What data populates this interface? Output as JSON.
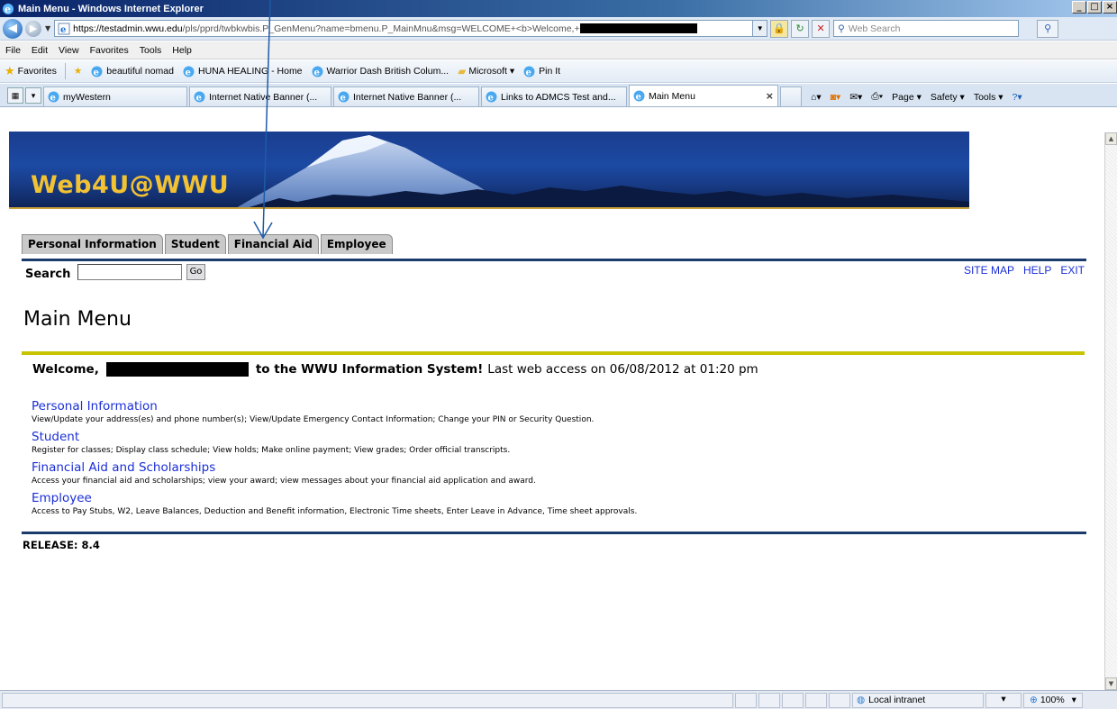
{
  "window": {
    "title": "Main Menu - Windows Internet Explorer",
    "min": "_",
    "max": "□",
    "close": "×"
  },
  "address": {
    "host": "https://testadmin.wwu.edu",
    "rest": "/pls/pprd/twbkwbis.P_GenMenu?name=bmenu.P_MainMnu&msg=WELCOME+<b>Welcome,+",
    "search_placeholder": "Web Search"
  },
  "menu": [
    "File",
    "Edit",
    "View",
    "Favorites",
    "Tools",
    "Help"
  ],
  "favorites": {
    "label": "Favorites",
    "items": [
      "beautiful nomad",
      "HUNA HEALING - Home",
      "Warrior Dash  British Colum...",
      "Microsoft ▾",
      "Pin It"
    ]
  },
  "tabs": [
    {
      "label": "myWestern"
    },
    {
      "label": "Internet Native Banner (..."
    },
    {
      "label": "Internet Native Banner (..."
    },
    {
      "label": "Links to ADMCS Test and..."
    },
    {
      "label": "Main Menu",
      "close": "×"
    }
  ],
  "commands": [
    "Page ▾",
    "Safety ▾",
    "Tools ▾"
  ],
  "site": {
    "banner_title": "Web4U@WWU",
    "nav_tabs": [
      "Personal Information",
      "Student",
      "Financial Aid",
      "Employee"
    ],
    "search_label": "Search",
    "go_label": "Go",
    "links": [
      "SITE MAP",
      "HELP",
      "EXIT"
    ],
    "page_title": "Main Menu",
    "welcome_prefix": "Welcome,",
    "welcome_suffix": "to the WWU Information System!",
    "last_access": "Last web access on 06/08/2012 at 01:20 pm",
    "items": [
      {
        "title": "Personal Information",
        "desc": "View/Update your address(es) and phone number(s); View/Update Emergency Contact Information; Change your PIN or Security Question."
      },
      {
        "title": "Student",
        "desc": "Register for classes; Display class schedule; View holds; Make online payment; View grades; Order official transcripts."
      },
      {
        "title": "Financial Aid and Scholarships",
        "desc": "Access your financial aid and scholarships; view your award; view messages about your financial aid application and award."
      },
      {
        "title": "Employee",
        "desc": "Access to Pay Stubs, W2, Leave Balances, Deduction and Benefit information, Electronic Time sheets, Enter Leave in Advance, Time sheet approvals."
      }
    ],
    "release": "RELEASE: 8.4"
  },
  "status": {
    "zone": "Local intranet",
    "zoom": "100%"
  },
  "colors": {
    "link": "#1a2ed6",
    "banner_title": "#f2c233",
    "rule_yellow": "#c8c400",
    "rule_navy": "#1a3b6b"
  }
}
